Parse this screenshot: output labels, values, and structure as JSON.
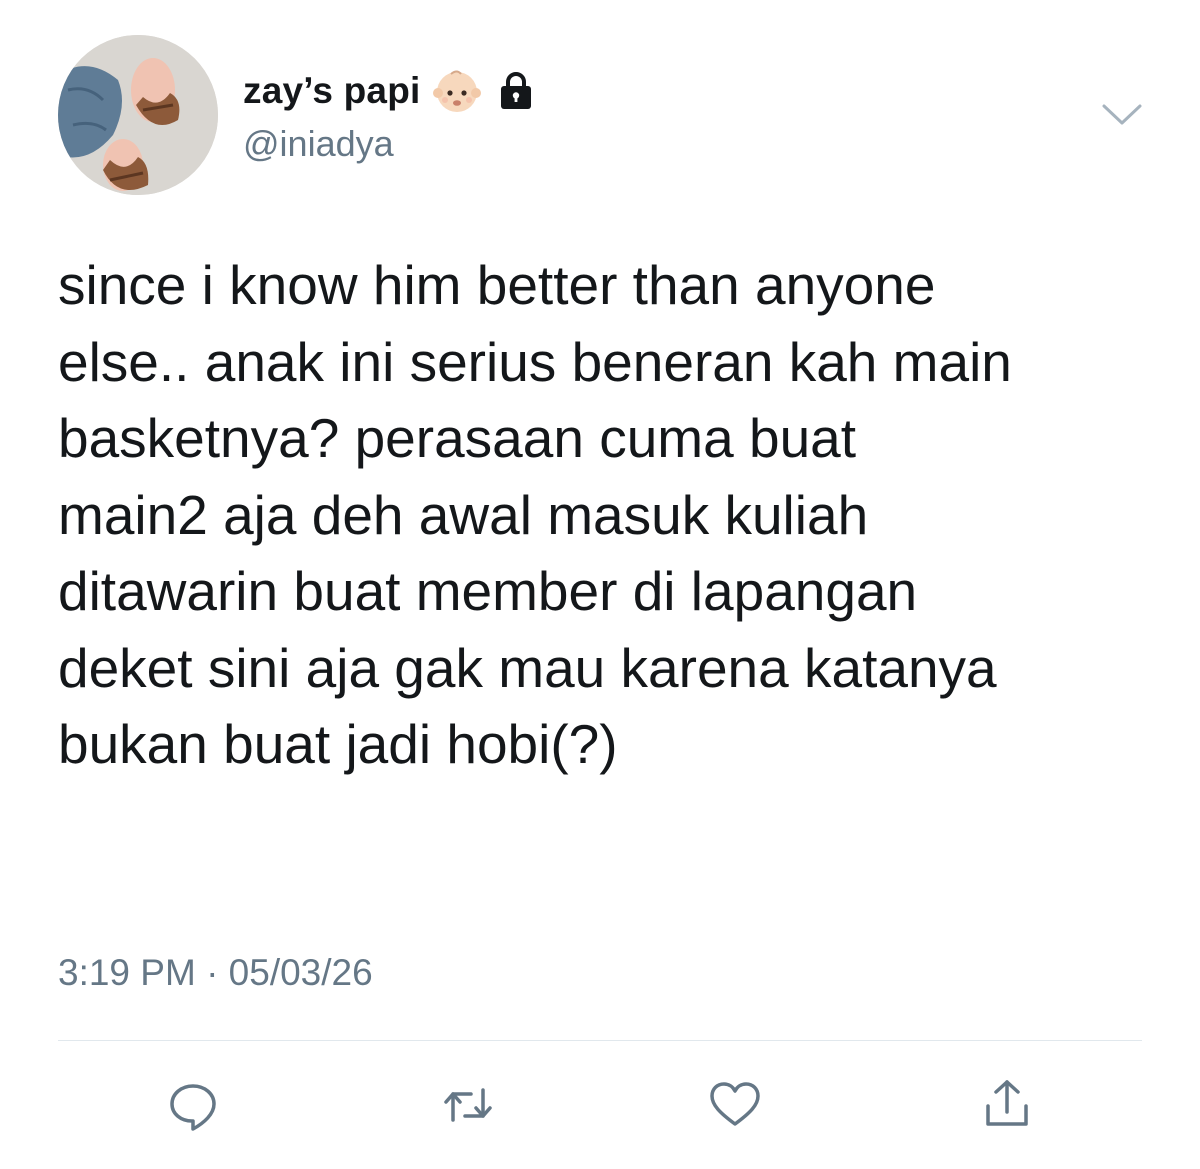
{
  "tweet": {
    "display_name": "zay’s papi",
    "handle": "@iniadya",
    "text": "since i know him better than anyone\nelse.. anak ini serius beneran kah main\nbasketnya? perasaan cuma buat\nmain2 aja deh awal masuk kuliah\nditawarin buat member di lapangan\ndeket sini aja gak mau karena katanya\nbukan buat jadi hobi(?)",
    "timestamp": "3:19 PM · 05/03/26",
    "badges": [
      "baby-emoji",
      "lock-icon"
    ]
  },
  "actions": [
    {
      "name": "reply",
      "icon": "reply-icon"
    },
    {
      "name": "retweet",
      "icon": "retweet-icon"
    },
    {
      "name": "like",
      "icon": "heart-icon"
    },
    {
      "name": "share",
      "icon": "share-icon"
    }
  ],
  "colors": {
    "text_primary": "#14171a",
    "text_secondary": "#657786",
    "divider": "#e1e8ed",
    "background": "#ffffff"
  }
}
